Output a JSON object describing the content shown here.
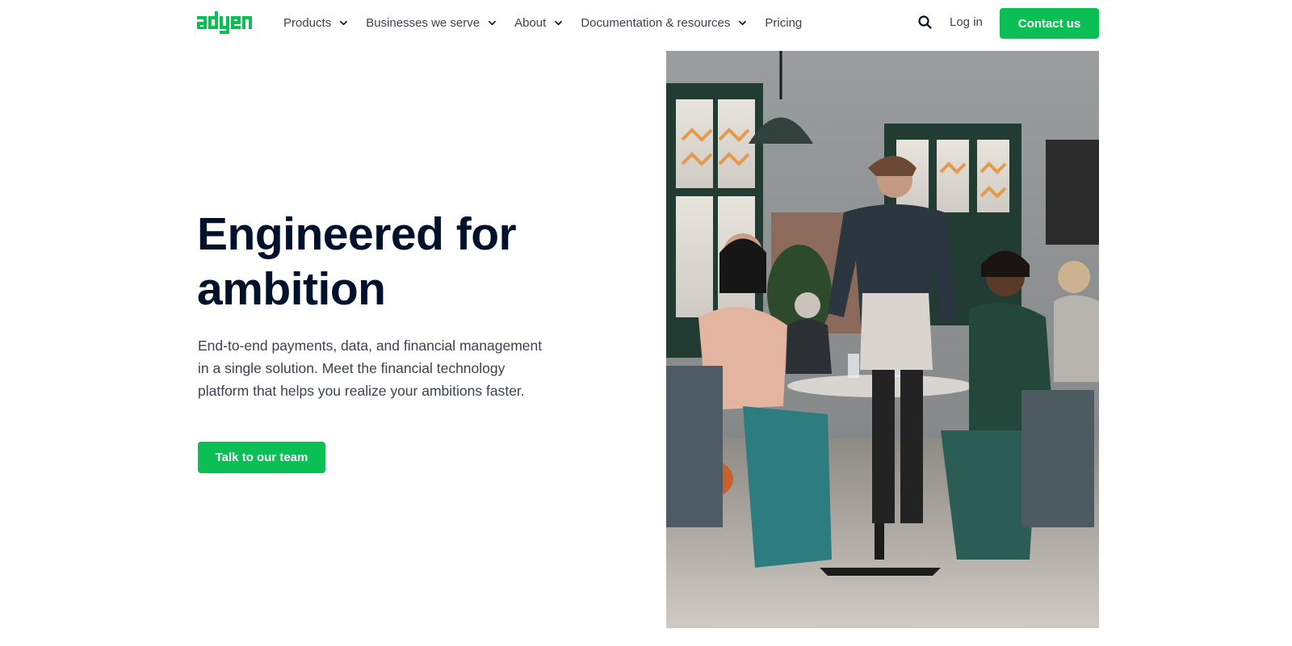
{
  "brand": {
    "logo_text": "adyen",
    "accent_color": "#0abf53"
  },
  "nav": {
    "items": [
      {
        "label": "Products",
        "has_dropdown": true
      },
      {
        "label": "Businesses we serve",
        "has_dropdown": true
      },
      {
        "label": "About",
        "has_dropdown": true
      },
      {
        "label": "Documentation & resources",
        "has_dropdown": true
      },
      {
        "label": "Pricing",
        "has_dropdown": false
      }
    ],
    "search_icon": "search-icon",
    "login_label": "Log in",
    "contact_label": "Contact us"
  },
  "hero": {
    "title": "Engineered for ambition",
    "subtitle": "End-to-end payments, data, and financial management in a single solution. Meet the financial technology platform that helps you realize your ambitions faster.",
    "cta_label": "Talk to our team",
    "image_description": "restaurant-scene"
  }
}
